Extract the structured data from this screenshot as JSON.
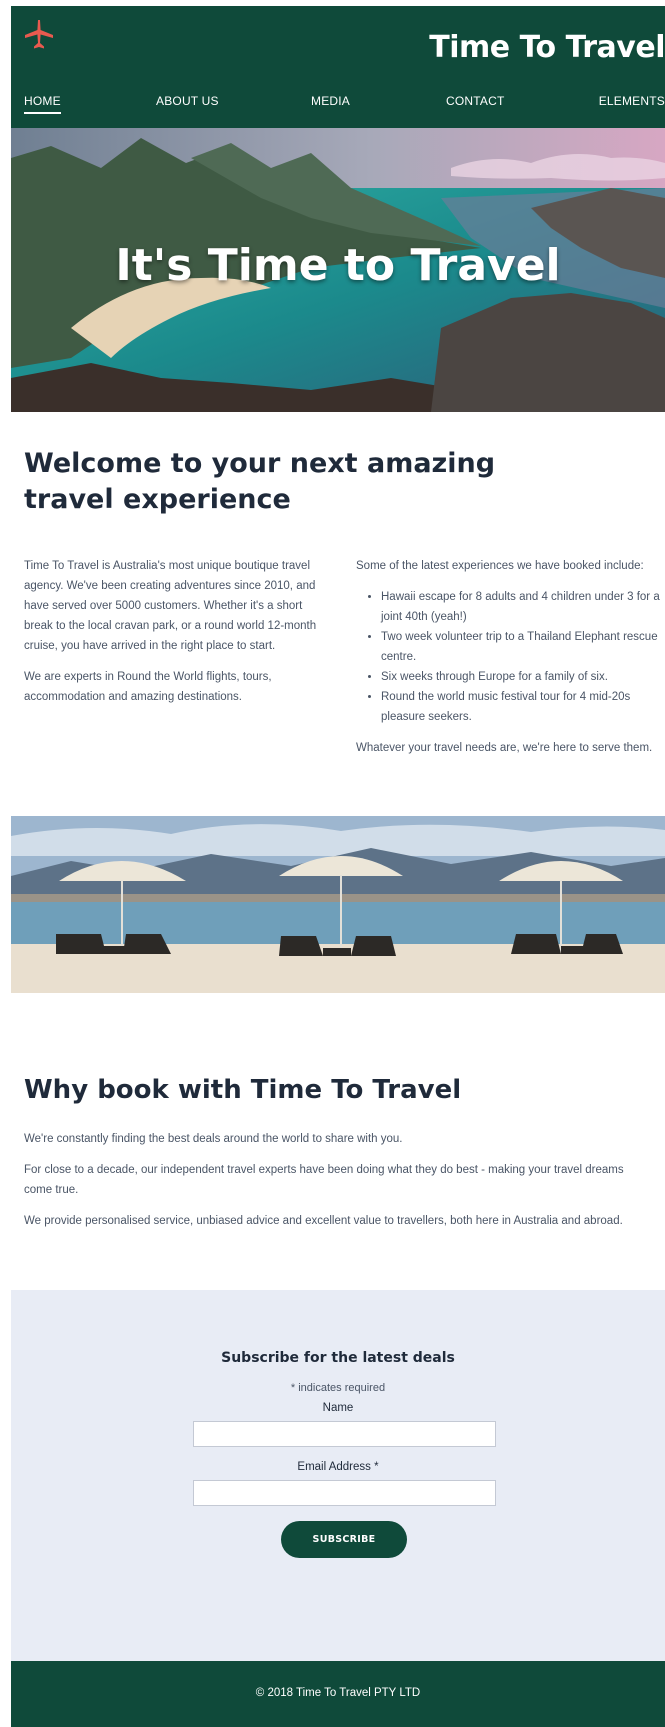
{
  "brand": {
    "title": "Time To Travel",
    "logo_icon": "airplane-icon",
    "logo_color": "#e85a4f"
  },
  "colors": {
    "primary": "#0f4a3a",
    "subscribe_bg": "#e8ecf5",
    "heading": "#1f2a3a"
  },
  "nav": [
    {
      "label": "HOME",
      "active": true
    },
    {
      "label": "ABOUT US",
      "active": false
    },
    {
      "label": "MEDIA",
      "active": false
    },
    {
      "label": "CONTACT",
      "active": false
    },
    {
      "label": "ELEMENTS",
      "active": false
    }
  ],
  "hero": {
    "title": "It's Time to Travel"
  },
  "welcome": {
    "heading": "Welcome to your next amazing travel experience",
    "left_paragraphs": [
      "Time To Travel is Australia's most unique boutique travel agency. We've been creating adventures since 2010, and have served over 5000 customers. Whether it's a short break to the local cravan park, or a round world 12-month cruise, you have arrived in the right place to start.",
      "We are experts in Round the World flights, tours, accommodation and amazing destinations."
    ],
    "right_intro": "Some of the latest experiences we have booked include:",
    "right_list": [
      "Hawaii escape for 8 adults and 4 children under 3 for a joint 40th (yeah!)",
      "Two week volunteer trip to a Thailand Elephant rescue centre.",
      "Six weeks through Europe for a family of six.",
      "Round the world music festival tour for 4 mid-20s pleasure seekers."
    ],
    "right_outro": "Whatever your travel needs are, we're here to serve them."
  },
  "why": {
    "heading": "Why book with Time To Travel",
    "paragraphs": [
      "We're constantly finding the best deals around the world to share with you.",
      "For close to a decade, our independent travel experts have been doing what they do best - making your travel dreams come true.",
      "We provide personalised service, unbiased advice and excellent value to travellers, both here in Australia and abroad."
    ]
  },
  "subscribe": {
    "heading": "Subscribe for the latest deals",
    "required_note": "* indicates required",
    "name_label": "Name",
    "name_value": "",
    "email_label": "Email Address *",
    "email_value": "",
    "button_label": "SUBSCRIBE"
  },
  "footer": {
    "copyright": "© 2018 Time To Travel PTY LTD"
  }
}
